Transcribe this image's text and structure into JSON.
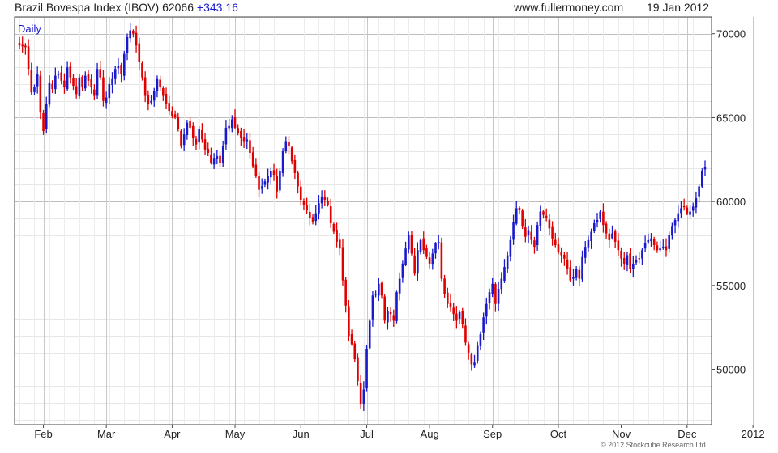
{
  "header": {
    "title": "Brazil Bovespa Index (IBOV)",
    "last": "62066",
    "change": "+343.16",
    "site": "www.fullermoney.com",
    "date": "19 Jan 2012"
  },
  "footer": {
    "copyright": "© 2012 Stockcube Research Ltd"
  },
  "colors": {
    "up": "#1a1acc",
    "down": "#e00000",
    "grid": "#cfcfcf",
    "axis": "#444444"
  },
  "chart_data": {
    "type": "ohlc",
    "period": "Daily",
    "ylim": [
      46700,
      71000
    ],
    "y_ticks": [
      50000,
      55000,
      60000,
      65000,
      70000
    ],
    "y_axis_side": "right",
    "grid": true,
    "x_tick_labels": [
      "Feb",
      "Mar",
      "Apr",
      "May",
      "Jun",
      "Jul",
      "Aug",
      "Sep",
      "Oct",
      "Nov",
      "Dec",
      "2012"
    ],
    "x_tick_index": [
      8,
      29,
      51,
      72,
      94,
      116,
      137,
      158,
      180,
      201,
      223,
      245
    ],
    "closes": [
      69300,
      69250,
      69200,
      67900,
      66500,
      66800,
      67600,
      65300,
      64200,
      65800,
      67100,
      66700,
      67500,
      67600,
      67200,
      66800,
      68000,
      67400,
      66900,
      66400,
      67400,
      66800,
      67500,
      67200,
      66800,
      66300,
      67900,
      67400,
      66000,
      66200,
      67000,
      67300,
      67900,
      68100,
      67600,
      68800,
      69800,
      70200,
      70000,
      69300,
      68300,
      67400,
      66300,
      65800,
      66000,
      66600,
      67300,
      66800,
      66300,
      65800,
      65400,
      65100,
      65000,
      64300,
      63300,
      64000,
      64700,
      64400,
      63800,
      63400,
      64300,
      63700,
      63100,
      62900,
      62300,
      62600,
      62700,
      62300,
      63300,
      64400,
      64500,
      64900,
      64400,
      64100,
      63800,
      63600,
      63700,
      62900,
      62100,
      61500,
      60700,
      60900,
      61200,
      61500,
      61800,
      61600,
      60600,
      61800,
      63000,
      63600,
      63300,
      62400,
      61700,
      60900,
      60100,
      59800,
      59500,
      59000,
      58800,
      59300,
      59900,
      60300,
      60100,
      59800,
      58700,
      58200,
      57600,
      57200,
      55300,
      53800,
      52000,
      51500,
      50600,
      49300,
      47900,
      48800,
      51200,
      52900,
      54400,
      54500,
      55100,
      54400,
      52900,
      53500,
      53300,
      52900,
      54600,
      55400,
      56300,
      57200,
      58000,
      56900,
      55700,
      57100,
      57700,
      57100,
      56700,
      56300,
      56900,
      57500,
      57600,
      55400,
      54500,
      53900,
      53700,
      53300,
      52900,
      53400,
      52700,
      51600,
      51000,
      50300,
      50400,
      51400,
      52100,
      53100,
      53900,
      54600,
      55100,
      53900,
      54800,
      55400,
      56100,
      56800,
      57700,
      58800,
      59600,
      59500,
      58500,
      57900,
      58300,
      57700,
      57300,
      58600,
      59400,
      59200,
      59000,
      58400,
      57800,
      57400,
      57000,
      56800,
      56600,
      56000,
      55300,
      55500,
      56000,
      55400,
      56700,
      57300,
      57700,
      58200,
      58700,
      58900,
      59400,
      58600,
      58100,
      57700,
      58100,
      57600,
      57100,
      56600,
      56300,
      56800,
      56000,
      56300,
      56500,
      56600,
      57100,
      57500,
      57700,
      57800,
      57400,
      57100,
      57200,
      57300,
      57100,
      58000,
      58500,
      58900,
      59300,
      59600,
      59700,
      59300,
      59400,
      59700,
      60200,
      60900,
      61800,
      62066
    ]
  }
}
